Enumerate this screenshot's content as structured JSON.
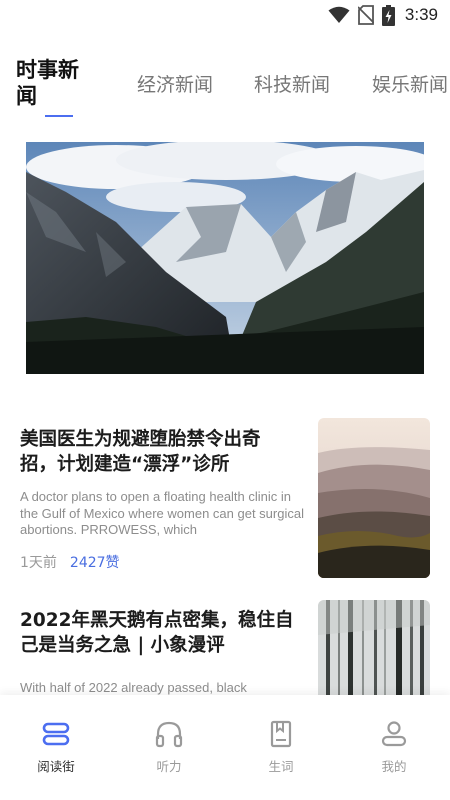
{
  "status_bar": {
    "time": "3:39",
    "icons": [
      "wifi-icon",
      "no-sim-icon",
      "battery-charging-icon"
    ]
  },
  "tabs": [
    {
      "label": "时事新闻",
      "active": true
    },
    {
      "label": "经济新闻",
      "active": false
    },
    {
      "label": "科技新闻",
      "active": false
    },
    {
      "label": "娱乐新闻",
      "active": false
    }
  ],
  "hero": {
    "image": "mountain-landscape"
  },
  "articles": [
    {
      "title": "美国医生为规避堕胎禁令出奇招，计划建造“漂浮”诊所",
      "excerpt": "A doctor plans to open a floating health clinic in the Gulf of Mexico where women can get surgical abortions. PRROWESS, which",
      "time": "1天前",
      "likes": "2427赞",
      "thumbnail": "misty-hills"
    },
    {
      "title": "2022年黑天鹅有点密集，稳住自己是当务之急 | 小象漫评",
      "excerpt": "With half of 2022 already passed, black",
      "thumbnail": "foggy-forest"
    }
  ],
  "bottom_nav": [
    {
      "label": "阅读街",
      "icon": "read-street-icon",
      "active": true
    },
    {
      "label": "听力",
      "icon": "headphones-icon",
      "active": false
    },
    {
      "label": "生词",
      "icon": "vocabulary-book-icon",
      "active": false
    },
    {
      "label": "我的",
      "icon": "profile-icon",
      "active": false
    }
  ],
  "colors": {
    "accent": "#4c6ef0",
    "likes": "#4a6ee0",
    "muted_text": "#9a9a9a"
  }
}
